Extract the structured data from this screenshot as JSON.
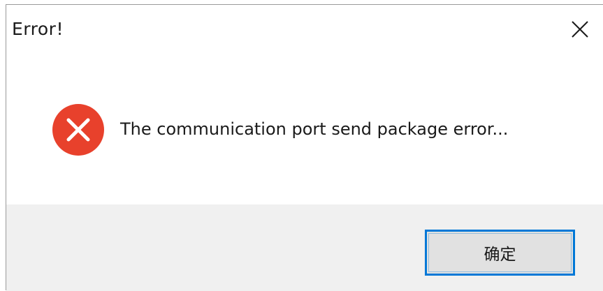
{
  "window": {
    "title": "Error!",
    "close_icon": "close-icon"
  },
  "content": {
    "icon": "error-icon",
    "message": "The communication port send package error..."
  },
  "buttons": {
    "ok_label": "确定"
  },
  "colors": {
    "error_red": "#e8412c",
    "focus_blue": "#0078d7",
    "footer_bg": "#f0f0f0",
    "button_bg": "#e1e1e1"
  }
}
